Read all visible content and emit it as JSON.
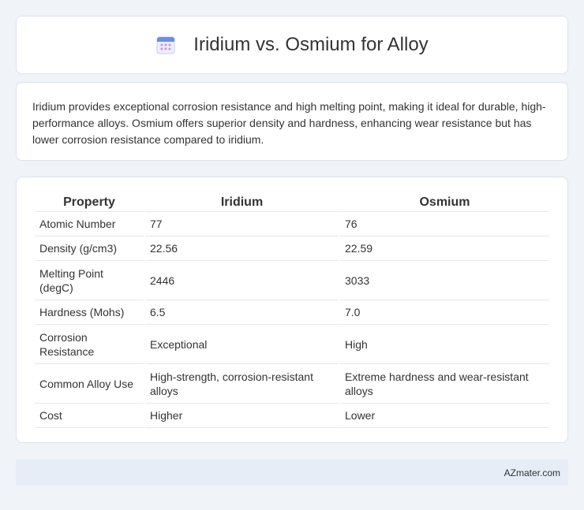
{
  "header": {
    "title": "Iridium vs. Osmium for Alloy",
    "icon": "calendar-icon",
    "icon_colors": {
      "top": "#6a8fe8",
      "body": "#eef0fb",
      "dots": "#c99be6"
    }
  },
  "summary": {
    "text": "Iridium provides exceptional corrosion resistance and high melting point, making it ideal for durable, high-performance alloys. Osmium offers superior density and hardness, enhancing wear resistance but has lower corrosion resistance compared to iridium."
  },
  "table": {
    "headers": [
      "Property",
      "Iridium",
      "Osmium"
    ],
    "rows": [
      [
        "Atomic Number",
        "77",
        "76"
      ],
      [
        "Density (g/cm3)",
        "22.56",
        "22.59"
      ],
      [
        "Melting Point (degC)",
        "2446",
        "3033"
      ],
      [
        "Hardness (Mohs)",
        "6.5",
        "7.0"
      ],
      [
        "Corrosion Resistance",
        "Exceptional",
        "High"
      ],
      [
        "Common Alloy Use",
        "High-strength, corrosion-resistant alloys",
        "Extreme hardness and wear-resistant alloys"
      ],
      [
        "Cost",
        "Higher",
        "Lower"
      ]
    ]
  },
  "footer": {
    "text": "AZmater.com"
  }
}
